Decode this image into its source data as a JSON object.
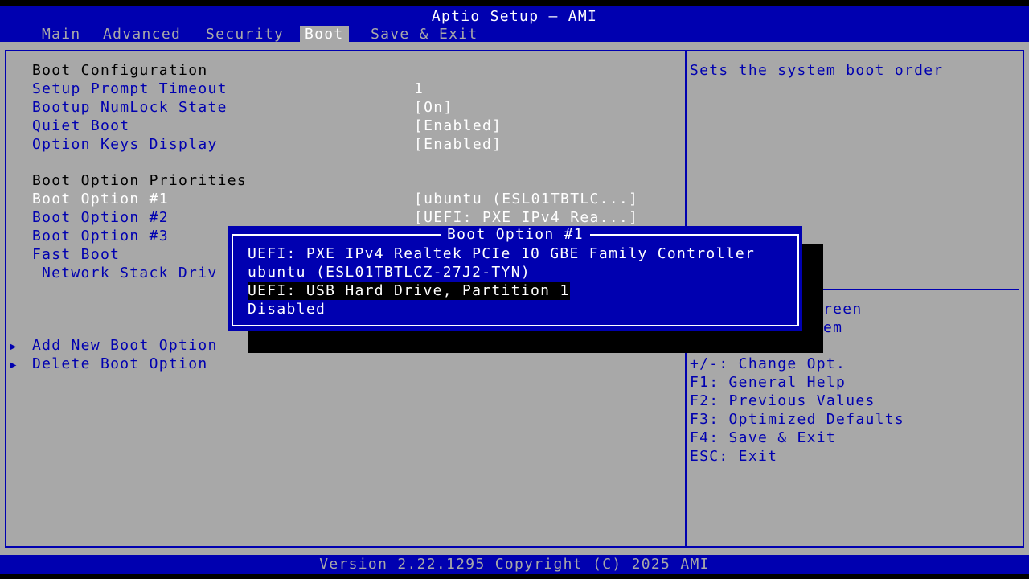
{
  "header": {
    "title": "Aptio Setup – AMI",
    "tabs": [
      "Main",
      "Advanced",
      "Security",
      "Boot",
      "Save & Exit"
    ],
    "active_tab": "Boot"
  },
  "settings": {
    "boot_configuration": "Boot Configuration",
    "setup_prompt_timeout": {
      "label": "Setup Prompt Timeout",
      "value": "1"
    },
    "bootup_numlock_state": {
      "label": "Bootup NumLock State",
      "value": "[On]"
    },
    "quiet_boot": {
      "label": "Quiet Boot",
      "value": "[Enabled]"
    },
    "option_keys_display": {
      "label": "Option Keys Display",
      "value": "[Enabled]"
    },
    "boot_option_priorities": "Boot Option Priorities",
    "boot_option_1": {
      "label": "Boot Option #1",
      "value": "[ubuntu (ESL01TBTLC...]"
    },
    "boot_option_2": {
      "label": "Boot Option #2",
      "value": "[UEFI: PXE IPv4 Rea...]"
    },
    "boot_option_3": {
      "label": "Boot Option #3"
    },
    "fast_boot": {
      "label": "Fast Boot"
    },
    "network_stack_driver": {
      "label": "Network Stack Driv"
    },
    "add_new_boot_option": "Add New Boot Option",
    "delete_boot_option": "Delete Boot Option",
    "submenu_arrow": "▶"
  },
  "help": {
    "description": "Sets the system boot order",
    "partial_1": "reen",
    "partial_2": "em",
    "keys": [
      "+/-: Change Opt.",
      "F1: General Help",
      "F2: Previous Values",
      "F3: Optimized Defaults",
      "F4: Save & Exit",
      "ESC: Exit"
    ]
  },
  "popup": {
    "title": "Boot Option #1",
    "options": [
      "UEFI: PXE IPv4 Realtek PCIe 10 GBE Family Controller",
      "ubuntu (ESL01TBTLCZ-27J2-TYN)",
      "UEFI: USB Hard Drive, Partition 1",
      "Disabled"
    ],
    "selected_index": 2
  },
  "footer": {
    "version": "Version 2.22.1295 Copyright (C) 2025 AMI"
  },
  "colors": {
    "blue": "#0000b0",
    "gray": "#a8a8a8",
    "white": "#ffffff",
    "black": "#000000"
  }
}
